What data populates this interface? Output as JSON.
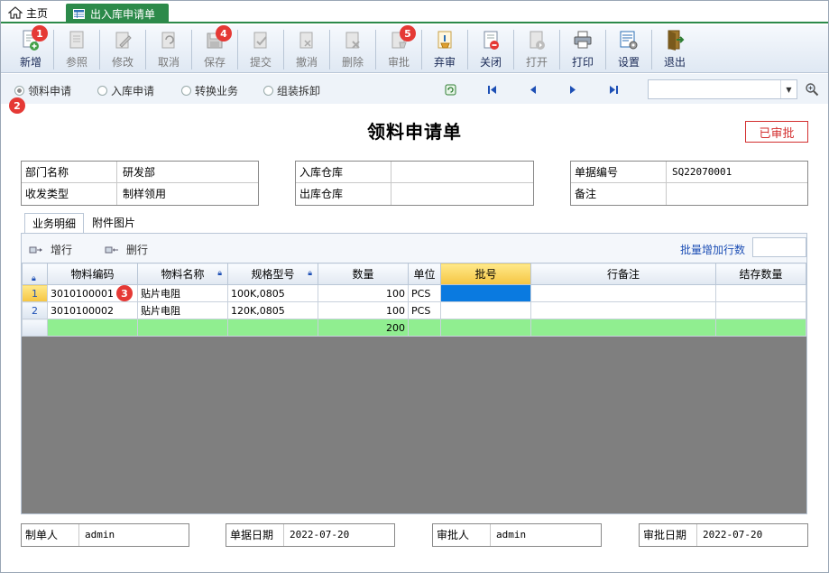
{
  "tabs": {
    "home": "主页",
    "active": "出入库申请单"
  },
  "toolbar": [
    {
      "label": "新增",
      "icon": "add-document-icon",
      "enabled": true,
      "badge": "1"
    },
    {
      "label": "参照",
      "icon": "reference-document-icon",
      "enabled": false
    },
    {
      "label": "修改",
      "icon": "edit-icon",
      "enabled": false
    },
    {
      "label": "取消",
      "icon": "undo-icon",
      "enabled": false
    },
    {
      "label": "保存",
      "icon": "save-icon",
      "enabled": false,
      "badge": "4"
    },
    {
      "label": "提交",
      "icon": "submit-icon",
      "enabled": false
    },
    {
      "label": "撤消",
      "icon": "revoke-icon",
      "enabled": false
    },
    {
      "label": "删除",
      "icon": "delete-icon",
      "enabled": false
    },
    {
      "label": "审批",
      "icon": "approve-icon",
      "enabled": false,
      "badge": "5"
    },
    {
      "label": "弃审",
      "icon": "unapprove-icon",
      "enabled": true
    },
    {
      "label": "关闭",
      "icon": "close-doc-icon",
      "enabled": true
    },
    {
      "label": "打开",
      "icon": "open-icon",
      "enabled": false
    },
    {
      "label": "打印",
      "icon": "printer-icon",
      "enabled": true
    },
    {
      "label": "设置",
      "icon": "settings-icon",
      "enabled": true
    },
    {
      "label": "退出",
      "icon": "exit-door-icon",
      "enabled": true
    }
  ],
  "radios": [
    "领料申请",
    "入库申请",
    "转换业务",
    "组装拆卸"
  ],
  "radio_badge": "2",
  "title": "领料申请单",
  "status_stamp": "已审批",
  "form": {
    "dept_label": "部门名称",
    "dept_value": "研发部",
    "type_label": "收发类型",
    "type_value": "制样领用",
    "in_wh_label": "入库仓库",
    "in_wh_value": "",
    "out_wh_label": "出库仓库",
    "out_wh_value": "",
    "doc_no_label": "单据编号",
    "doc_no_value": "SQ22070001",
    "remark_label": "备注",
    "remark_value": ""
  },
  "detail_tabs": [
    "业务明细",
    "附件图片"
  ],
  "grid_toolbar": {
    "add_row": "增行",
    "del_row": "删行",
    "batch_label": "批量增加行数"
  },
  "grid": {
    "columns": [
      "物料编码",
      "物料名称",
      "规格型号",
      "数量",
      "单位",
      "批号",
      "行备注",
      "结存数量"
    ],
    "rows": [
      {
        "no": "1",
        "code": "3010100001",
        "name": "贴片电阻",
        "spec": "100K,0805",
        "qty": "100",
        "unit": "PCS",
        "batch": "",
        "remark": "",
        "stock": ""
      },
      {
        "no": "2",
        "code": "3010100002",
        "name": "贴片电阻",
        "spec": "120K,0805",
        "qty": "100",
        "unit": "PCS",
        "batch": "",
        "remark": "",
        "stock": ""
      }
    ],
    "total_qty": "200",
    "row_badge": "3"
  },
  "footer": {
    "maker_label": "制单人",
    "maker_value": "admin",
    "date_label": "单据日期",
    "date_value": "2022-07-20",
    "approver_label": "审批人",
    "approver_value": "admin",
    "approve_date_label": "审批日期",
    "approve_date_value": "2022-07-20"
  }
}
